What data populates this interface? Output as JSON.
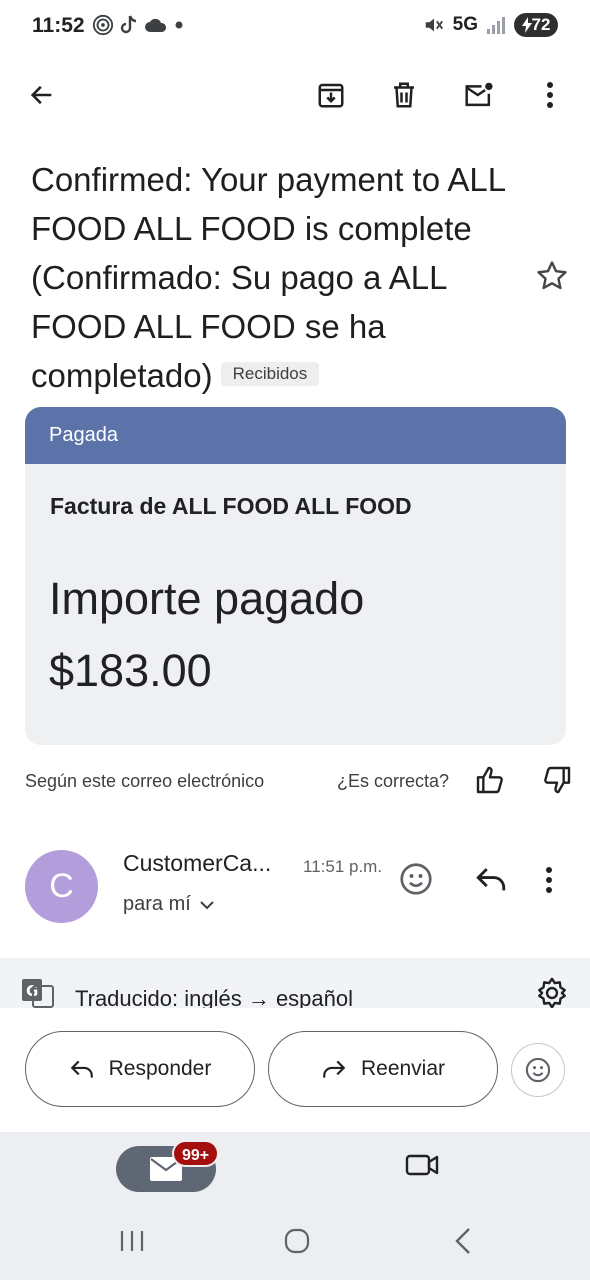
{
  "status_bar": {
    "time": "11:52",
    "network": "5G",
    "battery": "72"
  },
  "toolbar": {
    "icons": [
      "back-arrow-icon",
      "archive-icon",
      "delete-icon",
      "mark-unread-icon",
      "more-vert-icon"
    ]
  },
  "email": {
    "subject": "Confirmed: Your payment to ALL FOOD ALL FOOD is complete (Confirmado: Su pago a ALL FOOD ALL FOOD se ha completado)",
    "label": "Recibidos",
    "starred": false
  },
  "card": {
    "status": "Pagada",
    "title": "Factura de ALL FOOD ALL FOOD",
    "amount_label": "Importe pagado",
    "amount": "$183.00",
    "header_color": "#5b73a8"
  },
  "feedback": {
    "text": "Según este correo electrónico",
    "question": "¿Es correcta?"
  },
  "sender": {
    "avatar_letter": "C",
    "name": "CustomerCa...",
    "time": "11:51 p.m.",
    "to": "para mí",
    "avatar_color": "#b39ddb"
  },
  "translation": {
    "text": "Traducido: inglés → español"
  },
  "actions": {
    "reply": "Responder",
    "forward": "Reenviar"
  },
  "bottom_nav": {
    "mail_badge": "99+"
  }
}
